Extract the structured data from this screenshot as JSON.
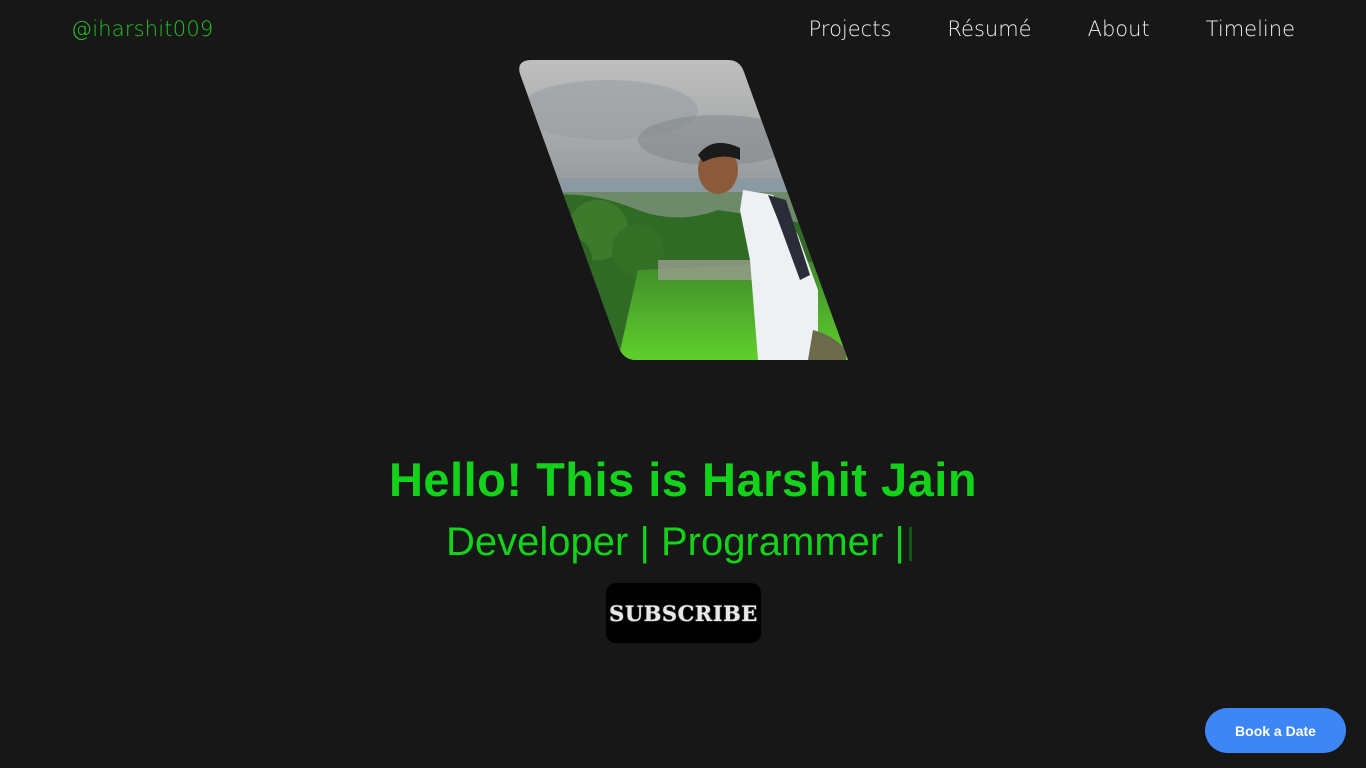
{
  "header": {
    "brand": "@iharshit009",
    "nav": [
      "Projects",
      "Résumé",
      "About",
      "Timeline"
    ]
  },
  "hero": {
    "title": "Hello! This is Harshit Jain",
    "roles": "Developer | Programmer |",
    "subscribe_label": "SUBSCRIBE"
  },
  "floating_button": {
    "label": "Book a Date"
  },
  "colors": {
    "background": "#171717",
    "accent_green": "#12d21a",
    "button_blue": "#3d86f5"
  }
}
